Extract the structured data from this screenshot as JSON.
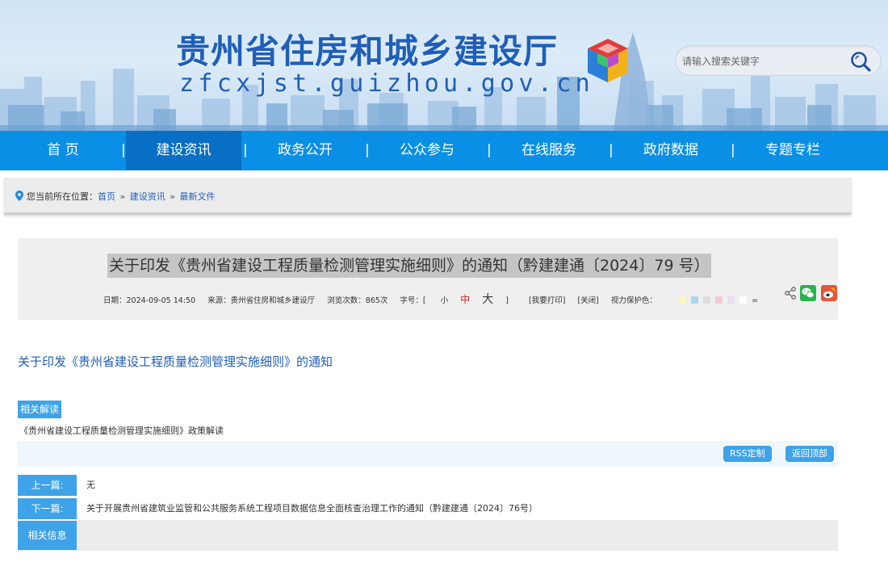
{
  "header": {
    "site_title": "贵州省住房和城乡建设厅",
    "site_domain": "zfcxjst.guizhou.gov.cn",
    "search": {
      "placeholder": "请输入搜索关键字"
    }
  },
  "nav": {
    "items": [
      {
        "label": "首 页"
      },
      {
        "label": "建设资讯",
        "active": true
      },
      {
        "label": "政务公开"
      },
      {
        "label": "公众参与"
      },
      {
        "label": "在线服务"
      },
      {
        "label": "政府数据"
      },
      {
        "label": "专题专栏"
      }
    ],
    "separator": "|"
  },
  "breadcrumb": {
    "prefix": "您当前所在位置：",
    "items": [
      "首页",
      "建设资讯",
      "最新文件"
    ],
    "separator": "»"
  },
  "article": {
    "title": "关于印发《贵州省建设工程质量检测管理实施细则》的通知（黔建建通〔2024〕79 号）",
    "meta": {
      "date": "日期：2024-09-05 14:50",
      "source": "来源：贵州省住房和城乡建设厅",
      "views": "浏览次数：865次",
      "font_label": "字号：[",
      "font_small": "小",
      "font_mid": "中",
      "font_big": "大",
      "font_end": "]",
      "print": "[我要打印]",
      "close": "[关闭]",
      "eye_label": "视力保护色：",
      "eye_colors": [
        "#fff7b8",
        "#a8d8f0",
        "#dcdcdc",
        "#f6c9d4",
        "#e8e0f4",
        "#ffffff"
      ],
      "eye_reset": "="
    },
    "body_link": "关于印发《贵州省建设工程质量检测管理实施细则》的通知"
  },
  "related_reading": {
    "tag": "相关解读",
    "items": [
      "《贵州省建设工程质量检测管理实施细则》政策解读"
    ]
  },
  "utility": {
    "rss": "RSS定制",
    "back_top": "返回顶部"
  },
  "prev_next": {
    "prev_label": "上一篇:",
    "prev_value": "无",
    "next_label": "下一篇:",
    "next_value": "关于开展贵州省建筑业监管和公共服务系统工程项目数据信息全面核查治理工作的通知（黔建建通〔2024〕76号）"
  },
  "related_info": {
    "label": "相关信息"
  },
  "colors": {
    "nav_bg": "#0a8fe6",
    "nav_active": "#076fc4",
    "accent": "#3ea3e8",
    "brand_text": "#1f5fb8"
  },
  "icons": [
    "location-pin-icon",
    "search-icon",
    "share-icon",
    "wechat-icon",
    "weibo-icon",
    "logo-cube-icon"
  ]
}
